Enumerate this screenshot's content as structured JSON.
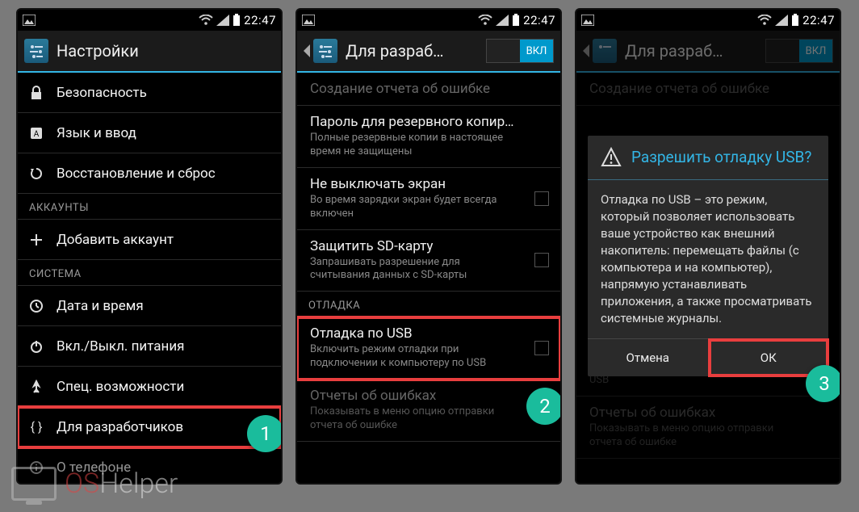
{
  "status": {
    "time": "22:47"
  },
  "screen1": {
    "title": "Настройки",
    "items": [
      {
        "icon": "lock-icon",
        "label": "Безопасность"
      },
      {
        "icon": "language-icon",
        "label": "Язык и ввод"
      },
      {
        "icon": "restore-icon",
        "label": "Восстановление и сброс"
      }
    ],
    "section_accounts": "АККАУНТЫ",
    "add_account": "Добавить аккаунт",
    "section_system": "СИСТЕМА",
    "system_items": [
      {
        "icon": "clock-icon",
        "label": "Дата и время"
      },
      {
        "icon": "power-icon",
        "label": "Вкл./Выкл. питания"
      },
      {
        "icon": "accessibility-icon",
        "label": "Спец. возможности"
      },
      {
        "icon": "developer-icon",
        "label": "Для разработчиков"
      },
      {
        "icon": "info-icon",
        "label": "О телефоне"
      }
    ],
    "badge": "1"
  },
  "screen2": {
    "title": "Для разраб…",
    "toggle_on": "ВКЛ",
    "items": [
      {
        "title": "Создание отчета об ошибке",
        "sub": "",
        "disabled": true
      },
      {
        "title": "Пароль для резервного копирования",
        "sub": "Полные резервные копии в настоящее время не защищены"
      },
      {
        "title": "Не выключать экран",
        "sub": "Во время зарядки экран будет всегда включен",
        "checkbox": true
      },
      {
        "title": "Защитить SD-карту",
        "sub": "Запрашивать разрешение для считывания данных с SD-карты",
        "checkbox": true
      }
    ],
    "section_debug": "ОТЛАДКА",
    "usb_item": {
      "title": "Отладка по USB",
      "sub": "Включить режим отладки при подключении к компьютеру по USB",
      "checkbox": true
    },
    "bugreport_item": {
      "title": "Отчеты об ошибках",
      "sub": "Показывать в меню опцию отправки отчета об ошибке"
    },
    "badge": "2"
  },
  "screen3": {
    "title": "Для разраб…",
    "toggle_on": "ВКЛ",
    "bg_item1": "Создание отчета об ошибке",
    "dialog": {
      "title": "Разрешить отладку USB?",
      "body": "Отладка по USB – это режим, который позволяет использовать ваше устройство как внешний накопитель: перемещать файлы (с компьютера и на компьютер), напрямую устанавливать приложения, а также просматривать системные журналы.",
      "cancel": "Отмена",
      "ok": "ОК"
    },
    "bg_usb": "USB",
    "bg_bugreport_title": "Отчеты об ошибках",
    "bg_bugreport_sub": "Показывать в меню опцию отправки отчета об ошибке",
    "badge": "3"
  },
  "watermark": {
    "part1": "OS",
    "part2": "Helper"
  }
}
